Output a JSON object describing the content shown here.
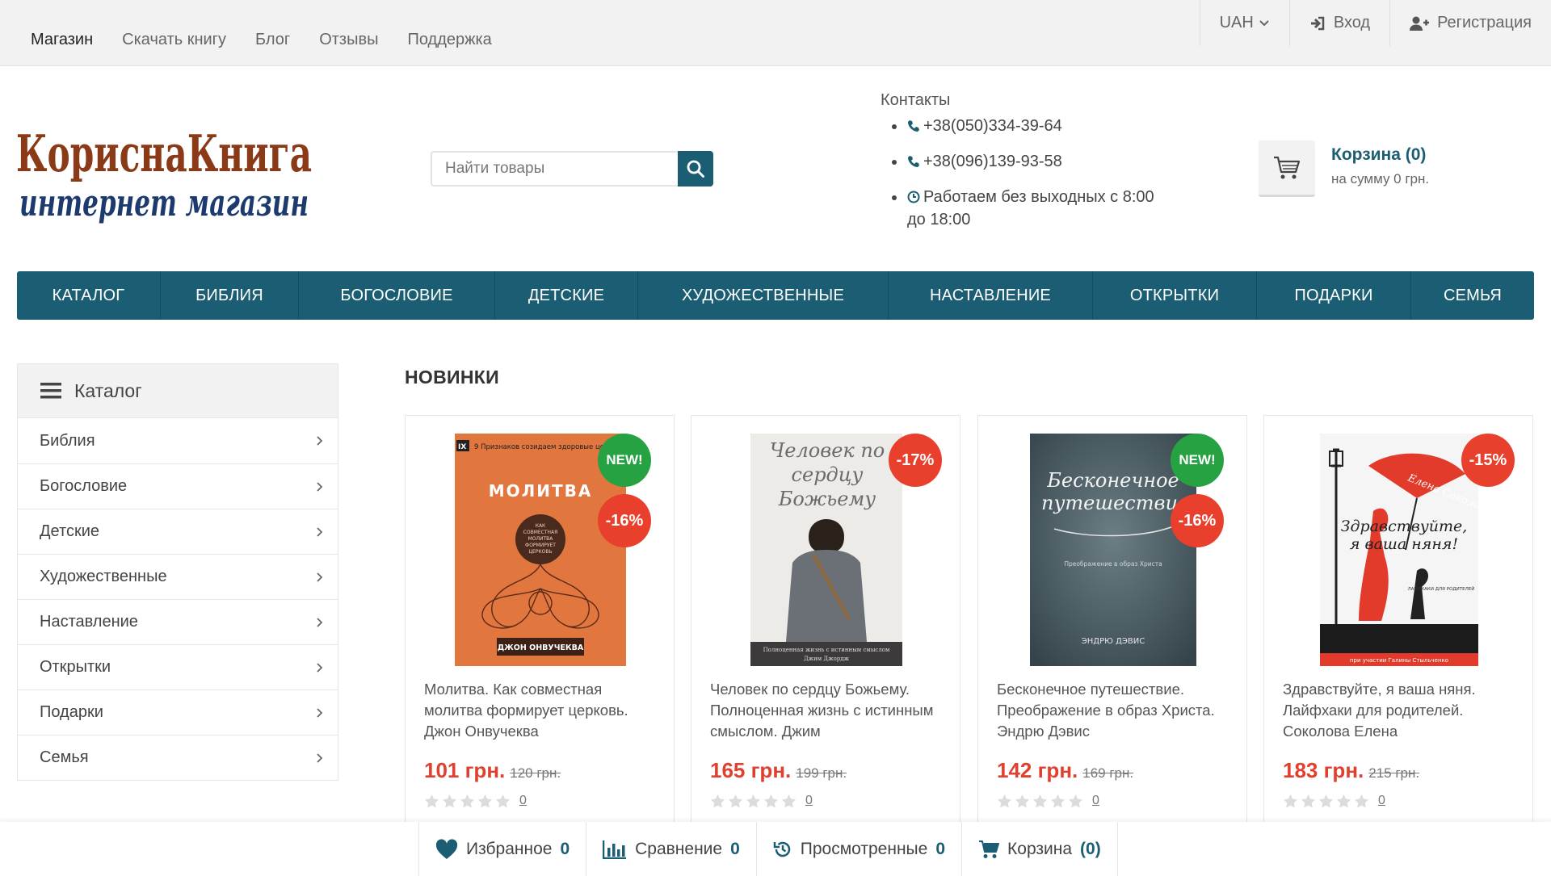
{
  "topnav": [
    "Магазин",
    "Скачать книгу",
    "Блог",
    "Отзывы",
    "Поддержка"
  ],
  "topright": {
    "currency": "UAH",
    "login": "Вход",
    "register": "Регистрация"
  },
  "logo": {
    "line1": "КориснаКнига",
    "line2": "интернет магазин"
  },
  "search": {
    "placeholder": "Найти товары"
  },
  "contacts": {
    "title": "Контакты",
    "phone1": "+38(050)334-39-64",
    "phone2": "+38(096)139-93-58",
    "hours": "Работаем без выходных с 8:00 до 18:00"
  },
  "cart": {
    "title": "Корзина (0)",
    "sum": "на сумму 0 грн."
  },
  "mainnav": [
    "КАТАЛОГ",
    "БИБЛИЯ",
    "БОГОСЛОВИЕ",
    "ДЕТСКИЕ",
    "ХУДОЖЕСТВЕННЫЕ",
    "НАСТАВЛЕНИЕ",
    "ОТКРЫТКИ",
    "ПОДАРКИ",
    "СЕМЬЯ"
  ],
  "sidebar": {
    "title": "Каталог",
    "items": [
      "Библия",
      "Богословие",
      "Детские",
      "Художественные",
      "Наставление",
      "Открытки",
      "Подарки",
      "Семья"
    ]
  },
  "section_title": "НОВИНКИ",
  "products": [
    {
      "title": "Молитва. Как совместная молитва формирует церковь. Джон Онвучеква",
      "price": "101 грн.",
      "old_price": "120 грн.",
      "badges": [
        "NEW!",
        "-16%"
      ],
      "reviews": "0",
      "cover": {
        "bg": "#e2763f",
        "header": "9 Признаков созидаем здоровые церкви",
        "title": "МОЛИТВА",
        "subtitle": "КАК СОВМЕСТНАЯ МОЛИТВА ФОРМИРУЕТ ЦЕРКОВЬ",
        "author": "ДЖОН ОНВУЧЕКВА"
      }
    },
    {
      "title": "Человек по сердцу Божьему. Полноценная жизнь с истинным смыслом. Джим",
      "price": "165 грн.",
      "old_price": "199 грн.",
      "badges": [
        "-17%"
      ],
      "reviews": "0",
      "cover": {
        "bg": "#ecebe8",
        "title": "Человек по сердцу Божьему",
        "subtitle": "Полноценная жизнь с истинным смыслом",
        "author": "Джим Джордж"
      }
    },
    {
      "title": "Бесконечное путешествие. Преображение в образ Христа. Эндрю Дэвис",
      "price": "142 грн.",
      "old_price": "169 грн.",
      "badges": [
        "NEW!",
        "-16%"
      ],
      "reviews": "0",
      "cover": {
        "bg": "#4a5b60",
        "title": "Бесконечное путешествие",
        "subtitle": "Преображение в образ Христа",
        "author": "ЭНДРЮ ДЭВИС"
      }
    },
    {
      "title": "Здравствуйте, я ваша няня. Лайфхаки для родителей. Соколова Елена",
      "price": "183 грн.",
      "old_price": "215 грн.",
      "badges": [
        "-15%"
      ],
      "reviews": "0",
      "cover": {
        "bg": "#f5f5f5",
        "author_top": "Елена Соколова",
        "title": "Здравствуйте, я ваша няня!",
        "subtitle": "ЛАЙФХАКИ ДЛЯ РОДИТЕЛЕЙ",
        "footer": "при участии Галины Стыльченко"
      }
    }
  ],
  "bottombar": [
    {
      "label": "Избранное",
      "count": "0"
    },
    {
      "label": "Сравнение",
      "count": "0"
    },
    {
      "label": "Просмотренные",
      "count": "0"
    },
    {
      "label": "Корзина",
      "count": "(0)"
    }
  ],
  "colors": {
    "brand": "#1b5e74",
    "price": "#e0402d",
    "badge_new": "#27a243",
    "badge_discount": "#e9402e",
    "logo_top": "#8b3a17",
    "logo_bottom": "#1d3a6e"
  }
}
